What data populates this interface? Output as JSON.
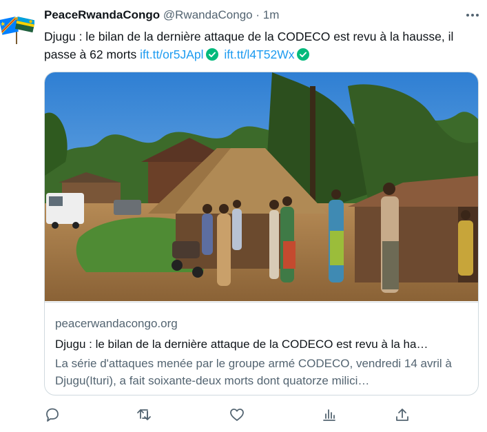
{
  "tweet": {
    "author_name": "PeaceRwandaCongo",
    "handle": "@RwandaCongo",
    "separator": "·",
    "time": "1m",
    "text": "Djugu : le bilan de la dernière attaque de la CODECO est revu à la hausse, il passe à 62 morts",
    "links": [
      "ift.tt/or5JApl",
      "ift.tt/l4T52Wx"
    ],
    "avatar_icon": "rwanda-congo-flags-icon",
    "verified_color": "#00ba7c",
    "link_color": "#1d9bf0"
  },
  "card": {
    "domain": "peacerwandacongo.org",
    "title": "Djugu : le bilan de la dernière attaque de la CODECO est revu à la ha…",
    "description": "La série d'attaques menée par le groupe armé CODECO, vendredi 14 avril à Djugu(Ituri), a fait soixante-deux morts dont quatorze milici…"
  },
  "actions": [
    "reply-icon",
    "retweet-icon",
    "like-icon",
    "views-icon",
    "share-icon"
  ]
}
